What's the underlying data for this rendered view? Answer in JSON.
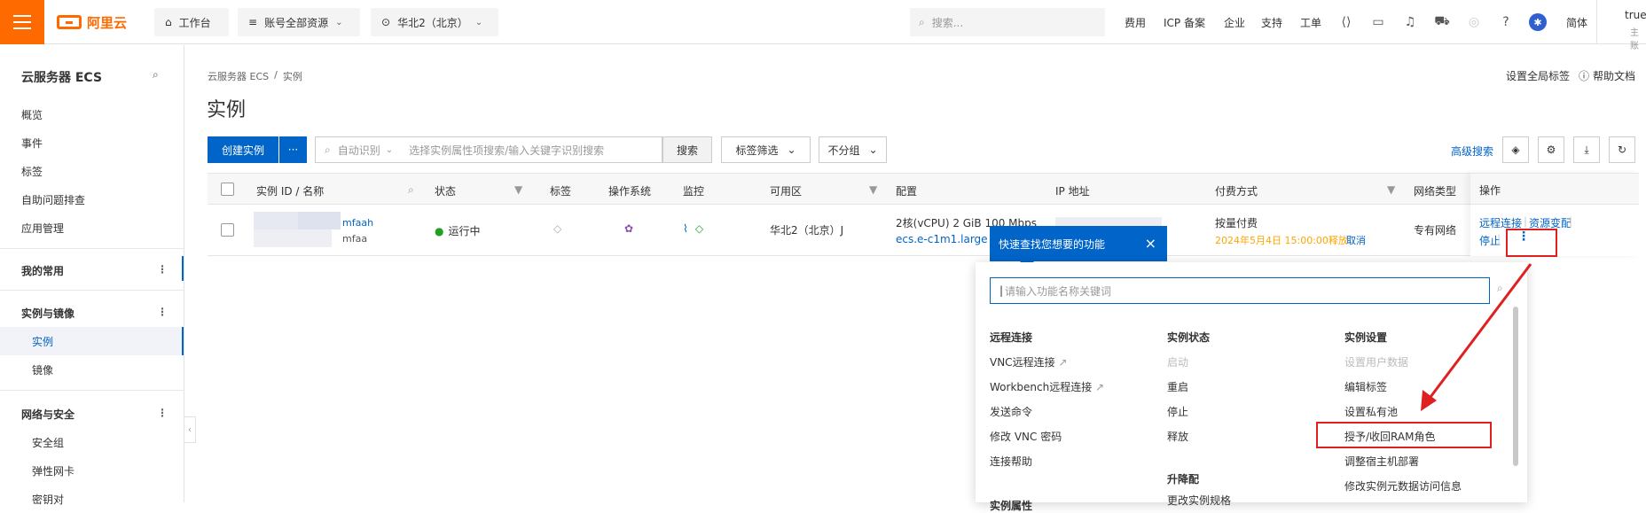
{
  "topbar": {
    "logo": "阿里云",
    "workbench": "工作台",
    "account": "账号全部资源",
    "region": "华北2（北京）",
    "search_placeholder": "搜索...",
    "nav": [
      "费用",
      "ICP 备案",
      "企业",
      "支持",
      "工单"
    ],
    "lang": "简体",
    "user": "true_",
    "user_sub": "主账"
  },
  "sidebar": {
    "title": "云服务器 ECS",
    "items": [
      "概览",
      "事件",
      "标签",
      "自助问题排查",
      "应用管理"
    ],
    "sections": [
      {
        "label": "我的常用"
      },
      {
        "label": "实例与镜像",
        "children": [
          "实例",
          "镜像"
        ]
      },
      {
        "label": "网络与安全",
        "children": [
          "安全组",
          "弹性网卡",
          "密钥对"
        ]
      }
    ]
  },
  "page": {
    "breadcrumb": [
      "云服务器 ECS",
      "/",
      "实例"
    ],
    "title": "实例",
    "global_tags": "设置全局标签",
    "help": "帮助文档",
    "create_btn": "创建实例",
    "more_btn": "···",
    "search_type": "自动识别",
    "search_placeholder": "选择实例属性项搜索/输入关键字识别搜索",
    "search_btn": "搜索",
    "tag_filter": "标签筛选",
    "no_group": "不分组",
    "advanced_search": "高级搜索"
  },
  "table": {
    "headers": [
      "实例 ID / 名称",
      "状态",
      "标签",
      "操作系统",
      "监控",
      "可用区",
      "配置",
      "IP 地址",
      "付费方式",
      "网络类型",
      "操作"
    ],
    "row": {
      "name_1": "mfaah",
      "name_2": "mfaa",
      "status": "运行中",
      "zone": "华北2（北京）J",
      "config": "2核(vCPU)  2 GiB 100 Mbps",
      "spec": "ecs.e-c1m1.large",
      "billing": "按量付费",
      "release": "2024年5月4日 15:00:00释放",
      "cancel": "取消",
      "network": "专有网络",
      "op_remote": "远程连接",
      "op_change": "资源变配",
      "op_stop": "停止",
      "op_sep": "|"
    }
  },
  "tooltip": {
    "text": "快速查找您想要的功能",
    "close": "×"
  },
  "panel": {
    "search_placeholder": "请输入功能名称关键词",
    "col1": {
      "title": "远程连接",
      "items": [
        "VNC远程连接",
        "Workbench远程连接",
        "发送命令",
        "修改 VNC 密码",
        "连接帮助"
      ],
      "next": "实例属性"
    },
    "col2": {
      "title": "实例状态",
      "items": [
        "启动",
        "重启",
        "停止",
        "释放"
      ],
      "title2": "升降配",
      "items2": [
        "更改实例规格"
      ]
    },
    "col3": {
      "title": "实例设置",
      "items": [
        "设置用户数据",
        "编辑标签",
        "设置私有池",
        "授予/收回RAM角色",
        "调整宿主机部署",
        "修改实例元数据访问信息"
      ]
    }
  },
  "colors": {
    "brand": "#ff6a00",
    "primary": "#0064c8",
    "running": "#20a020",
    "release": "#ffa500",
    "annotation": "#e02020"
  }
}
